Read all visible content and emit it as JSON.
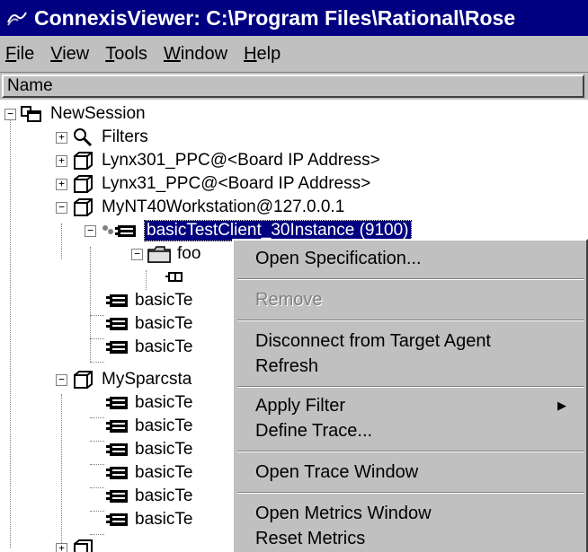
{
  "window": {
    "title": "ConnexisViewer: C:\\Program Files\\Rational\\Rose"
  },
  "menubar": {
    "items": [
      {
        "label": "File",
        "mnemonic": "F",
        "rest": "ile"
      },
      {
        "label": "View",
        "mnemonic": "V",
        "rest": "iew"
      },
      {
        "label": "Tools",
        "mnemonic": "T",
        "rest": "ools"
      },
      {
        "label": "Window",
        "mnemonic": "W",
        "rest": "indow"
      },
      {
        "label": "Help",
        "mnemonic": "H",
        "rest": "elp"
      }
    ]
  },
  "tree": {
    "column_header": "Name",
    "rows": [
      {
        "label": "NewSession",
        "icon": "session-icon",
        "expander": "minus"
      },
      {
        "label": "Filters",
        "icon": "filters-icon",
        "expander": "plus"
      },
      {
        "label": "Lynx301_PPC@<Board IP Address>",
        "icon": "target-window-icon",
        "expander": "plus"
      },
      {
        "label": "Lynx31_PPC@<Board IP Address>",
        "icon": "target-window-icon",
        "expander": "plus"
      },
      {
        "label": "MyNT40Workstation@127.0.0.1",
        "icon": "target-window-icon",
        "expander": "minus"
      },
      {
        "label": "basicTestClient_30Instance (9100)",
        "icon": "connected-component-icon",
        "expander": "minus",
        "selected": true
      },
      {
        "label": "foo",
        "icon": "folder-icon",
        "expander": "minus"
      },
      {
        "label": "",
        "icon": "port-icon",
        "expander": ""
      },
      {
        "label": "basicTe",
        "icon": "component-icon",
        "expander": ""
      },
      {
        "label": "basicTe",
        "icon": "component-icon",
        "expander": ""
      },
      {
        "label": "basicTe",
        "icon": "component-icon",
        "expander": ""
      },
      {
        "label": "MySparcsta",
        "icon": "target-window-icon",
        "expander": "minus"
      },
      {
        "label": "basicTe",
        "icon": "component-icon",
        "expander": ""
      },
      {
        "label": "basicTe",
        "icon": "component-icon",
        "expander": ""
      },
      {
        "label": "basicTe",
        "icon": "component-icon",
        "expander": ""
      },
      {
        "label": "basicTe",
        "icon": "component-icon",
        "expander": ""
      },
      {
        "label": "basicTe",
        "icon": "component-icon",
        "expander": ""
      },
      {
        "label": "basicTe",
        "icon": "component-icon",
        "expander": ""
      }
    ]
  },
  "context_menu": {
    "items": [
      {
        "label": "Open Specification...",
        "mnemonic": "O",
        "enabled": true
      },
      {
        "label": "Remove",
        "mnemonic": "R",
        "enabled": false
      },
      {
        "label": "Disconnect from Target Agent",
        "enabled": true
      },
      {
        "label": "Refresh",
        "mnemonic": "e",
        "enabled": true
      },
      {
        "label": "Apply Filter",
        "enabled": true,
        "submenu": true
      },
      {
        "label": "Define Trace...",
        "mnemonic": "D",
        "enabled": true
      },
      {
        "label": "Open Trace Window",
        "mnemonic": "T",
        "enabled": true
      },
      {
        "label": "Open Metrics Window",
        "mnemonic": "M",
        "enabled": true
      },
      {
        "label": "Reset Metrics",
        "mnemonic": "s",
        "enabled": true
      }
    ]
  },
  "colors": {
    "title_bar": "#000080",
    "chrome": "#c0c0c0",
    "selection": "#000080"
  }
}
